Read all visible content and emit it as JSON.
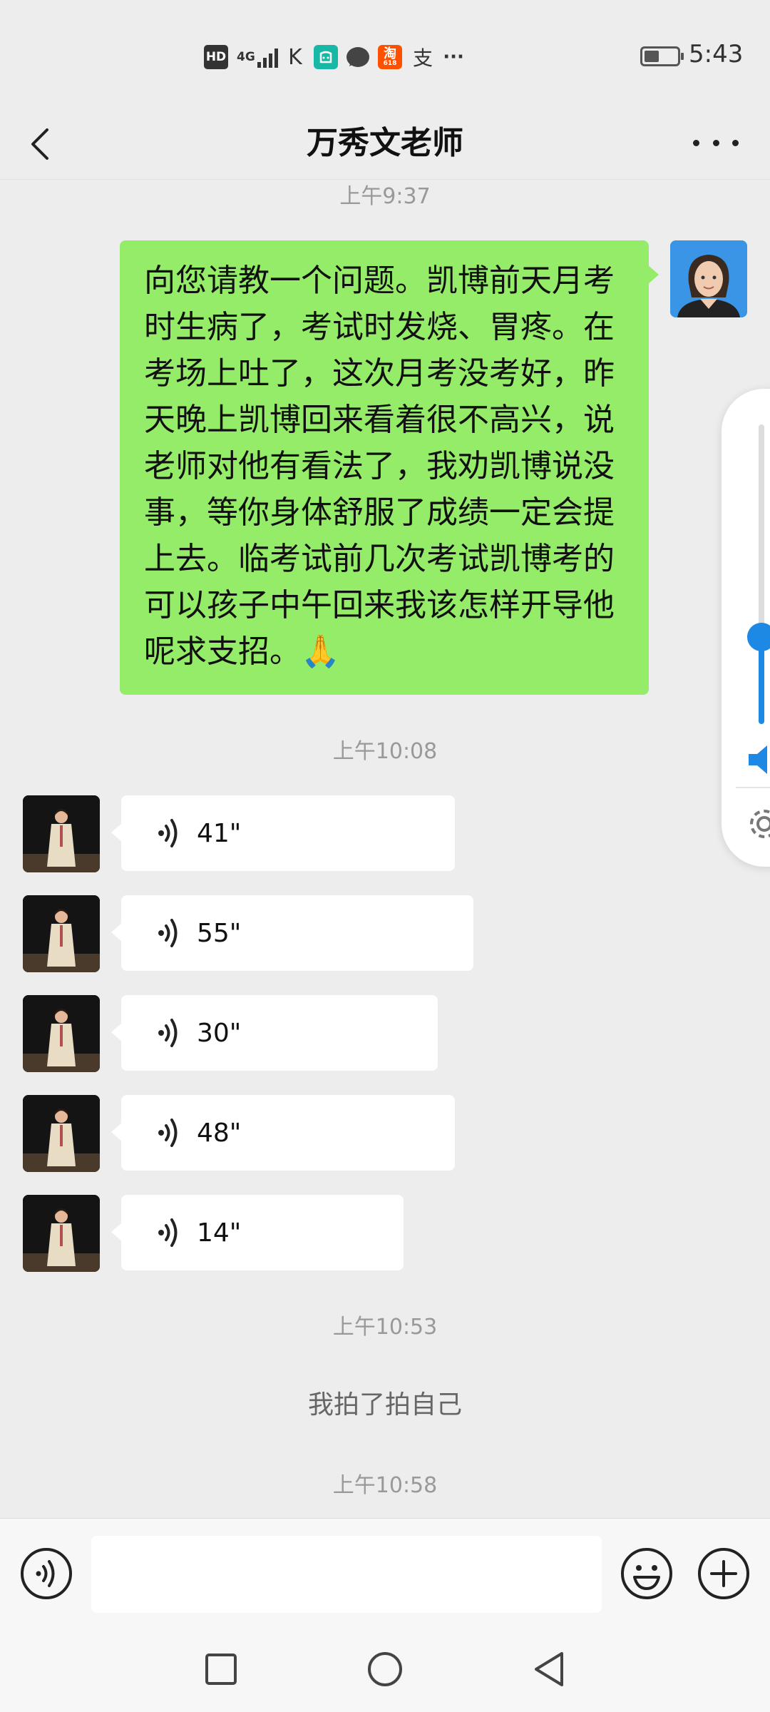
{
  "status_bar": {
    "hd": "HD",
    "network": "4G",
    "taobao_badge": "618",
    "alipay": "支",
    "more": "···",
    "time": "5:43",
    "icons": [
      "hd-icon",
      "signal-icon",
      "k-app-icon",
      "mi-app-icon",
      "message-icon",
      "taobao-icon",
      "alipay-icon",
      "more-notifications-icon",
      "battery-icon"
    ]
  },
  "header": {
    "title": "万秀文老师",
    "back_icon": "chevron-left-icon",
    "more_icon": "more-dots-icon"
  },
  "chat": {
    "time_1": "上午9:37",
    "sent_message": "向您请教一个问题。凯博前天月考时生病了，考试时发烧、胃疼。在考场上吐了，这次月考没考好，昨天晚上凯博回来看着很不高兴，说老师对他有看法了，我劝凯博说没事，等你身体舒服了成绩一定会提上去。临考试前几次考试凯博考的可以孩子中午回来我该怎样开导他呢求支招。",
    "sent_emoji": "🙏",
    "time_2": "上午10:08",
    "voice_messages": [
      {
        "duration": "41\""
      },
      {
        "duration": "55\""
      },
      {
        "duration": "30\""
      },
      {
        "duration": "48\""
      },
      {
        "duration": "14\""
      }
    ],
    "time_3": "上午10:53",
    "system_message": "我拍了拍自己",
    "time_4": "上午10:58"
  },
  "volume_panel": {
    "level": 0.29,
    "accent": "#1e88e5",
    "icons": [
      "speaker-icon",
      "gear-icon"
    ]
  },
  "input_bar": {
    "placeholder": "",
    "icons": [
      "voice-input-icon",
      "emoji-icon",
      "plus-icon"
    ]
  },
  "colors": {
    "background": "#ededed",
    "sent_bubble": "#95ec69",
    "received_bubble": "#ffffff"
  }
}
